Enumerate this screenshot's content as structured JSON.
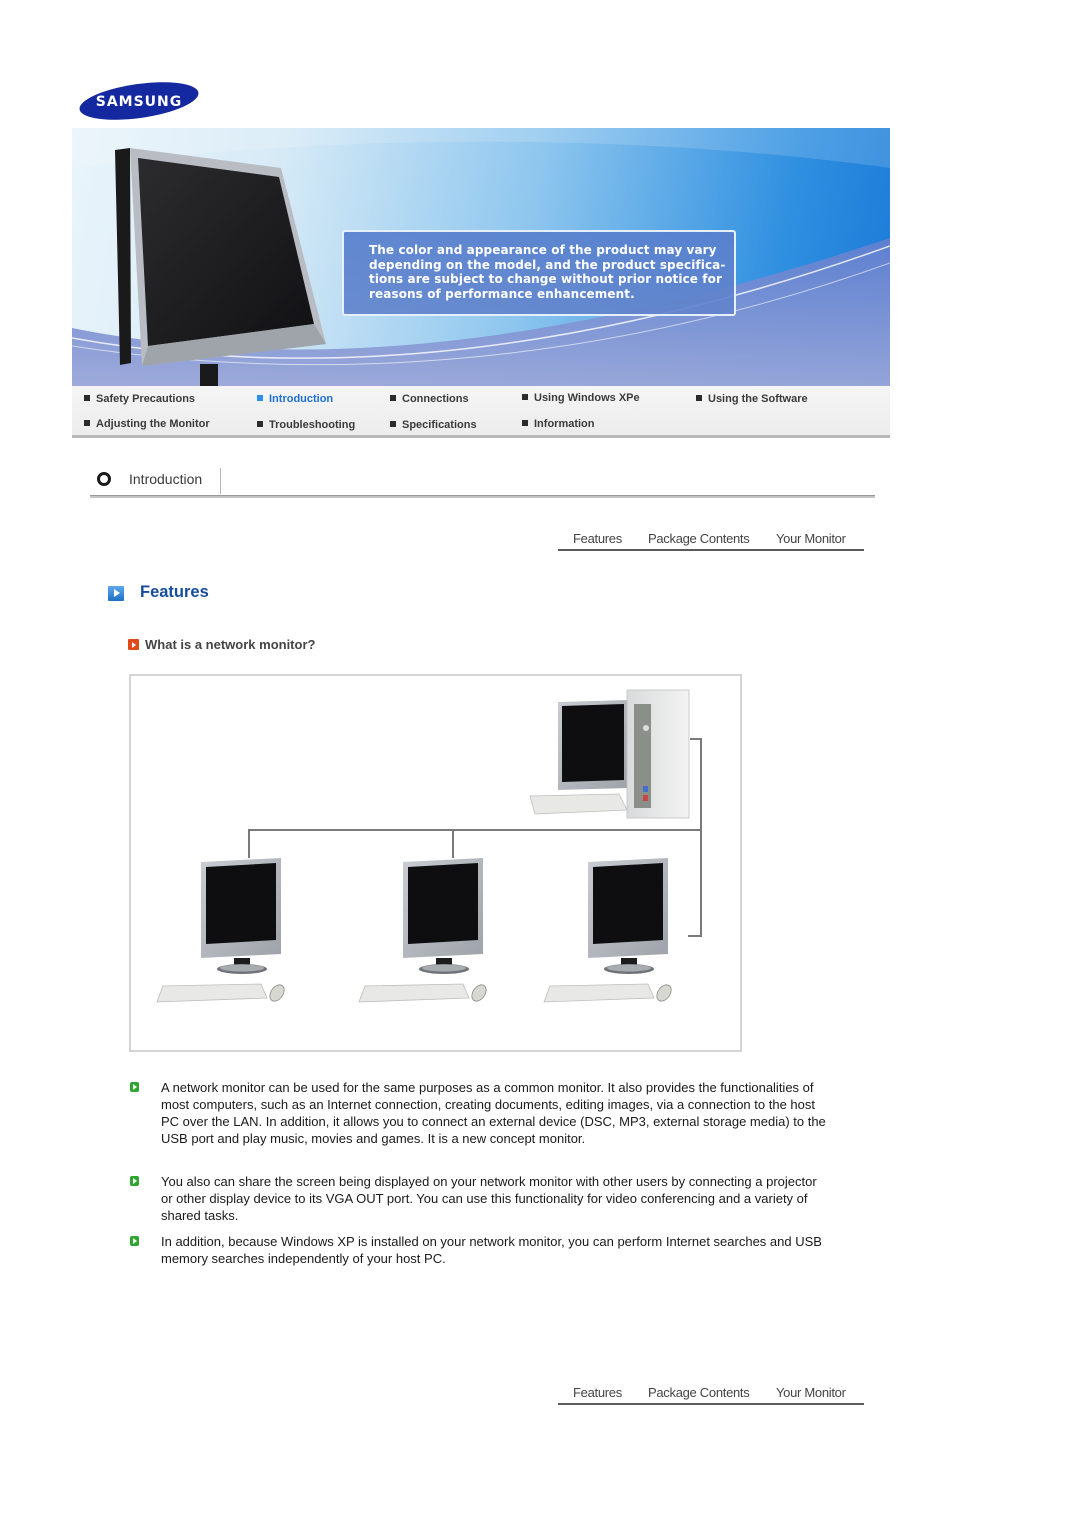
{
  "brand": {
    "logo_text": "SAMSUNG",
    "logo_color": "#1428a0"
  },
  "banner": {
    "notice_text": "The color and appearance of the product may vary depending on the model, and the product specifications are subject to change without prior notice for reasons of performance enhancement.",
    "notice_lines": [
      "The color and appearance of the product may vary",
      "depending on the model, and the product specifica-",
      "tions are subject to change without prior notice for",
      "reasons of performance enhancement."
    ]
  },
  "nav": {
    "active_color": "#1e6fd1",
    "items": [
      {
        "label": "Safety Precautions",
        "active": false
      },
      {
        "label": "Introduction",
        "active": true
      },
      {
        "label": "Connections",
        "active": false
      },
      {
        "label": "Using Windows XPe",
        "active": false
      },
      {
        "label": "Using the Software",
        "active": false
      },
      {
        "label": "Adjusting the Monitor",
        "active": false
      },
      {
        "label": "Troubleshooting",
        "active": false
      },
      {
        "label": "Specifications",
        "active": false
      },
      {
        "label": "Information",
        "active": false
      }
    ]
  },
  "section": {
    "title": "Introduction"
  },
  "subnav": {
    "items": [
      {
        "label": "Features"
      },
      {
        "label": "Package Contents"
      },
      {
        "label": "Your Monitor"
      }
    ]
  },
  "content": {
    "heading": "Features",
    "heading_color": "#154d9a",
    "subheading": "What is a network monitor?",
    "diagram": {
      "description": "Network diagram: host PC with monitor connected by lines to three network monitors with keyboards and mice",
      "host": "host-pc",
      "clients": [
        "network-monitor-1",
        "network-monitor-2",
        "network-monitor-3"
      ]
    },
    "bullets": [
      {
        "text": "A network monitor can be used for the same purposes as a common monitor. It also provides the functionalities of most computers, such as an Internet connection, creating documents, editing images, via a connection to the host PC over the LAN. In addition, it allows you to connect an external device (DSC, MP3, external storage media) to the USB port and play music, movies and games. It is a new concept monitor."
      },
      {
        "text": "You also can share the screen being displayed on your network monitor with other users by connecting a projector or other display device to its VGA OUT port. You can use this functionality for video conferencing and a variety of shared tasks."
      },
      {
        "text": "In addition, because Windows XP is installed on your network monitor, you can perform Internet searches and USB memory searches independently of your host PC."
      }
    ]
  }
}
